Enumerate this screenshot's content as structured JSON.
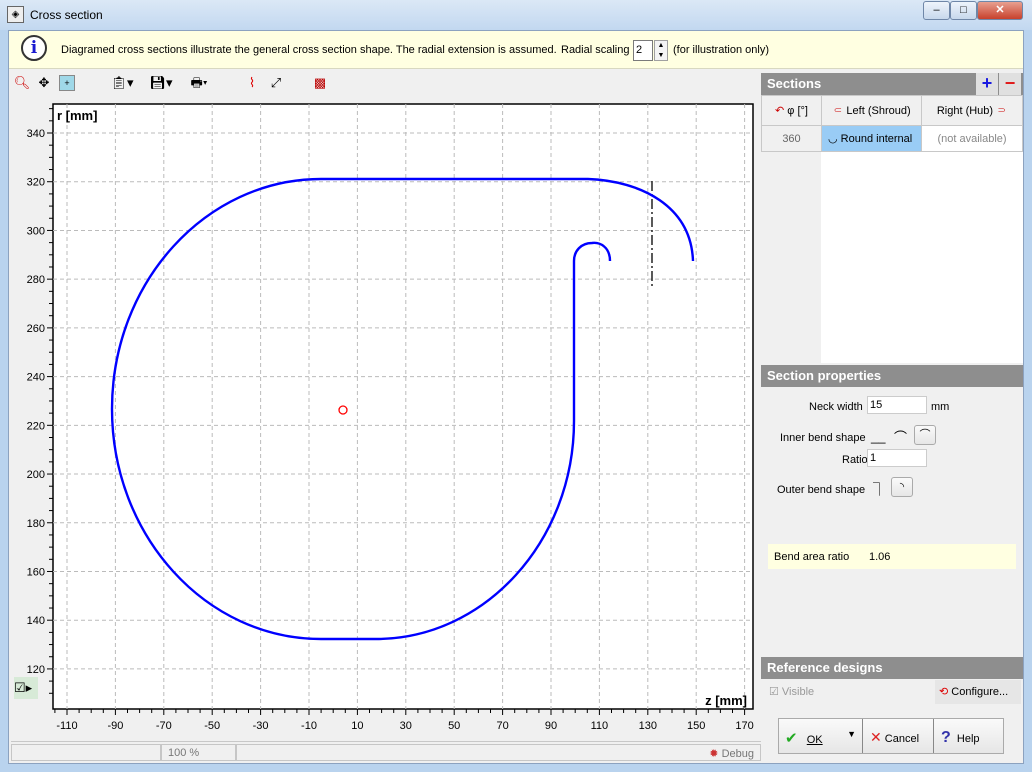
{
  "window": {
    "title": "Cross section",
    "minimize": "–",
    "maximize": "□",
    "close": "✕"
  },
  "info": {
    "text": "Diagramed cross sections illustrate the general cross section shape. The radial extension is assumed.",
    "radial_label": "Radial scaling",
    "radial_value": "2",
    "radial_note": "(for illustration only)"
  },
  "toolbar": {
    "icons": [
      "zoom-icon",
      "pan-icon",
      "fit-icon",
      "export-icon",
      "save-icon",
      "print-icon",
      "open-icon",
      "measure-icon",
      "colors-icon"
    ]
  },
  "plot": {
    "ylabel": "r [mm]",
    "xlabel": "z [mm]",
    "xticks": [
      "-110",
      "-90",
      "-70",
      "-50",
      "-30",
      "-10",
      "10",
      "30",
      "50",
      "70",
      "90",
      "110",
      "130",
      "150",
      "170"
    ],
    "yticks": [
      "340",
      "320",
      "300",
      "280",
      "260",
      "240",
      "220",
      "200",
      "180",
      "160",
      "140",
      "120"
    ],
    "curve_color": "#0000ff",
    "marker_color": "#ff0000"
  },
  "status": {
    "zoom": "100 %",
    "debug": "Debug"
  },
  "sections": {
    "title": "Sections",
    "add": "+",
    "remove": "−",
    "headers": {
      "phi": "φ [°]",
      "left": "Left (Shroud)",
      "right": "Right (Hub)"
    },
    "rows": [
      {
        "phi": "360",
        "left": "Round internal",
        "right": "(not available)"
      }
    ]
  },
  "properties": {
    "title": "Section properties",
    "neck_label": "Neck width",
    "neck_value": "15",
    "neck_unit": "mm",
    "inner_label": "Inner bend shape",
    "ratio_label": "Ratio",
    "ratio_value": "1",
    "outer_label": "Outer bend shape",
    "bend_ratio_label": "Bend area ratio",
    "bend_ratio_value": "1.06"
  },
  "reference": {
    "title": "Reference designs",
    "visible": "Visible",
    "configure": "Configure..."
  },
  "buttons": {
    "ok": "OK",
    "cancel": "Cancel",
    "help": "Help"
  }
}
